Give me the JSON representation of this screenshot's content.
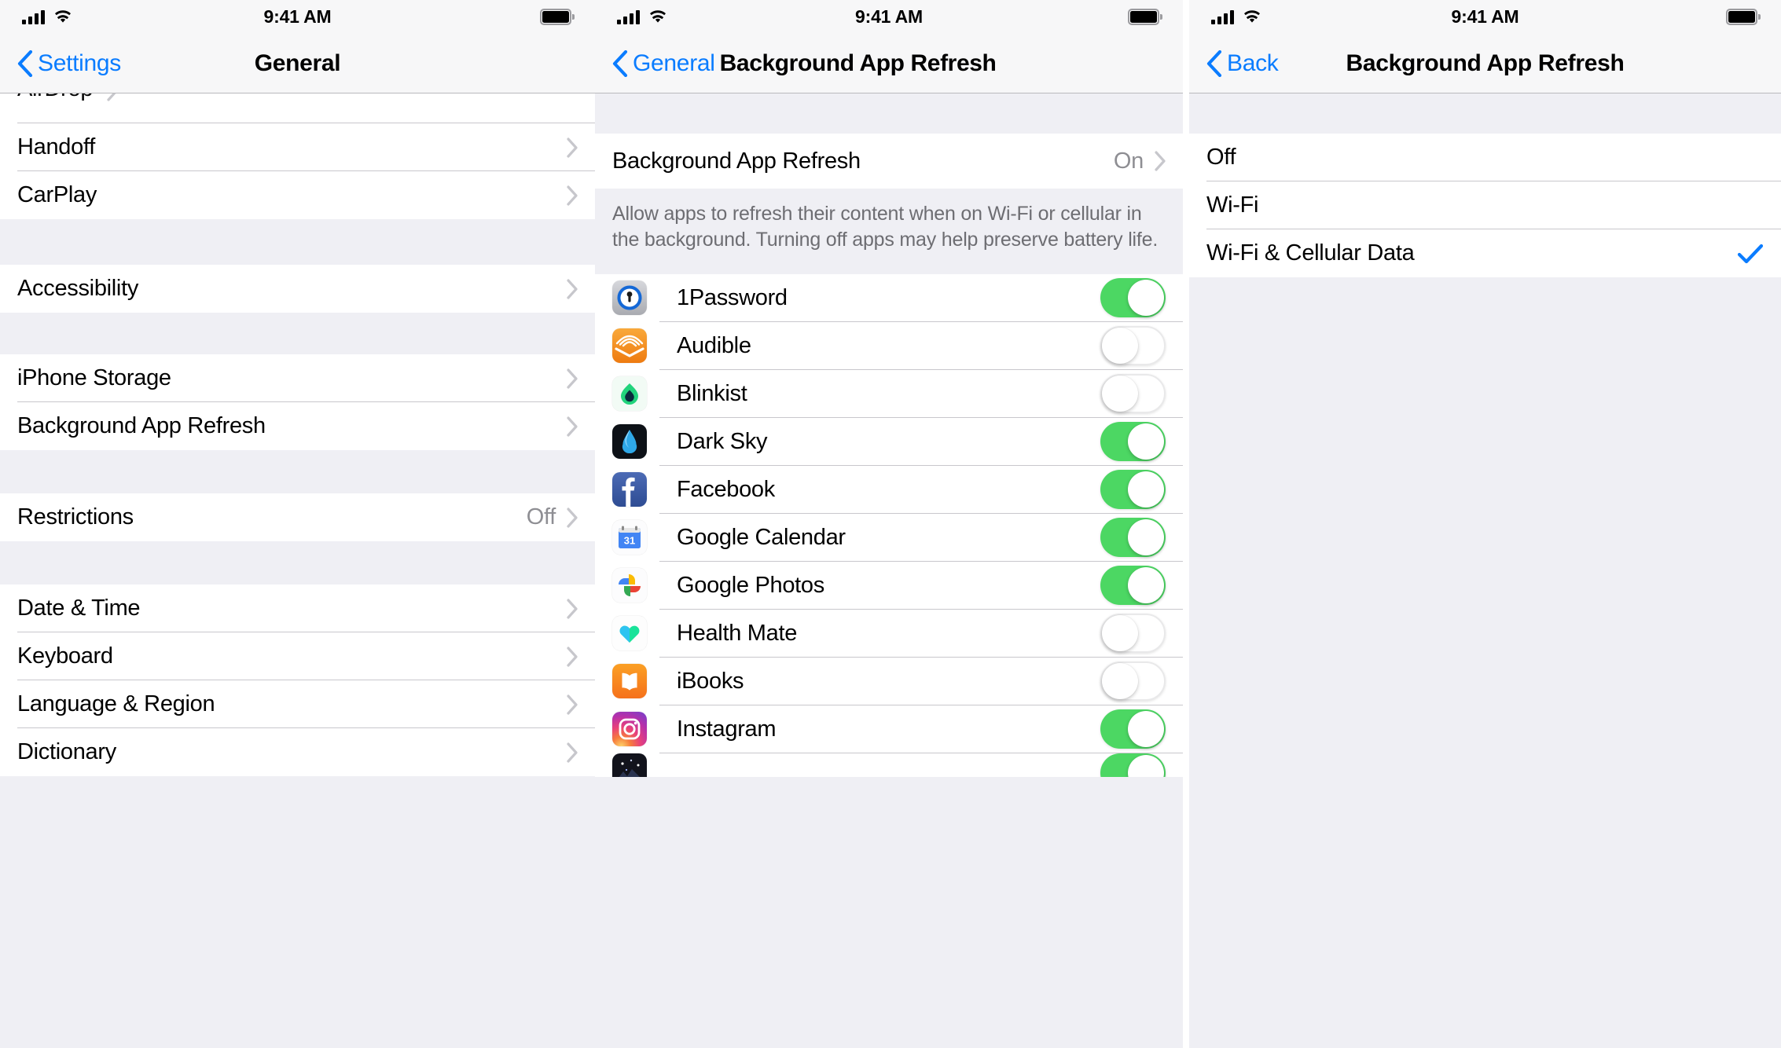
{
  "status_bar": {
    "time": "9:41 AM",
    "signal_icon": "cellular-bars-icon",
    "wifi_icon": "wifi-icon",
    "battery_icon": "battery-full-icon"
  },
  "colors": {
    "tint": "#0a7cff",
    "toggle_on": "#4cd763",
    "separator": "#c8c7cc",
    "group_bg": "#efeff4",
    "secondary_text": "#8e8e93"
  },
  "panel_general": {
    "nav": {
      "back_label": "Settings",
      "title": "General",
      "back_icon": "chevron-left-icon"
    },
    "groups": [
      {
        "rows": [
          {
            "label": "AirDrop",
            "value": "",
            "accessory": "chevron-right-icon",
            "clipped": true
          },
          {
            "label": "Handoff",
            "value": "",
            "accessory": "chevron-right-icon"
          },
          {
            "label": "CarPlay",
            "value": "",
            "accessory": "chevron-right-icon"
          }
        ]
      },
      {
        "rows": [
          {
            "label": "Accessibility",
            "value": "",
            "accessory": "chevron-right-icon"
          }
        ]
      },
      {
        "rows": [
          {
            "label": "iPhone Storage",
            "value": "",
            "accessory": "chevron-right-icon"
          },
          {
            "label": "Background App Refresh",
            "value": "",
            "accessory": "chevron-right-icon"
          }
        ]
      },
      {
        "rows": [
          {
            "label": "Restrictions",
            "value": "Off",
            "accessory": "chevron-right-icon"
          }
        ]
      },
      {
        "rows": [
          {
            "label": "Date & Time",
            "value": "",
            "accessory": "chevron-right-icon"
          },
          {
            "label": "Keyboard",
            "value": "",
            "accessory": "chevron-right-icon"
          },
          {
            "label": "Language & Region",
            "value": "",
            "accessory": "chevron-right-icon"
          },
          {
            "label": "Dictionary",
            "value": "",
            "accessory": "chevron-right-icon"
          }
        ]
      }
    ]
  },
  "panel_bar_list": {
    "nav": {
      "back_label": "General",
      "title": "Background App Refresh",
      "back_icon": "chevron-left-icon"
    },
    "master_row": {
      "label": "Background App Refresh",
      "value": "On",
      "accessory": "chevron-right-icon"
    },
    "footer_note": "Allow apps to refresh their content when on Wi-Fi or cellular in the background. Turning off apps may help preserve battery life.",
    "apps": [
      {
        "name": "1Password",
        "icon": "1password-icon",
        "enabled": true
      },
      {
        "name": "Audible",
        "icon": "audible-icon",
        "enabled": false
      },
      {
        "name": "Blinkist",
        "icon": "blinkist-icon",
        "enabled": false
      },
      {
        "name": "Dark Sky",
        "icon": "dark-sky-icon",
        "enabled": true
      },
      {
        "name": "Facebook",
        "icon": "facebook-icon",
        "enabled": true
      },
      {
        "name": "Google Calendar",
        "icon": "google-calendar-icon",
        "enabled": true
      },
      {
        "name": "Google Photos",
        "icon": "google-photos-icon",
        "enabled": true
      },
      {
        "name": "Health Mate",
        "icon": "health-mate-icon",
        "enabled": false
      },
      {
        "name": "iBooks",
        "icon": "ibooks-icon",
        "enabled": false
      },
      {
        "name": "Instagram",
        "icon": "instagram-icon",
        "enabled": true
      },
      {
        "name": "",
        "icon": "night-sky-app-icon",
        "enabled": true,
        "clipped": true
      }
    ]
  },
  "panel_options": {
    "nav": {
      "back_label": "Back",
      "title": "Background App Refresh",
      "back_icon": "chevron-left-icon"
    },
    "options": [
      {
        "label": "Off",
        "selected": false
      },
      {
        "label": "Wi-Fi",
        "selected": false
      },
      {
        "label": "Wi-Fi & Cellular Data",
        "selected": true,
        "accessory": "checkmark-icon"
      }
    ]
  }
}
